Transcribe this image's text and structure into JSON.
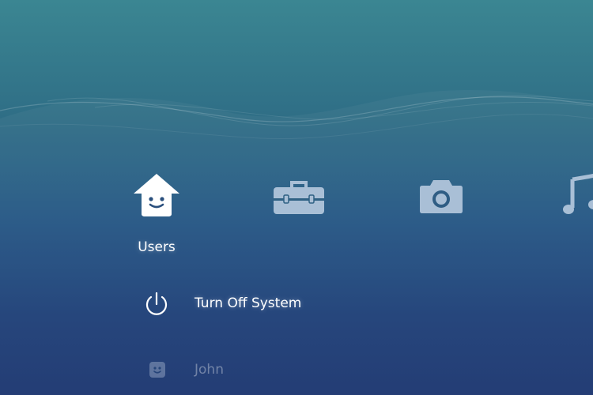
{
  "categories": [
    {
      "id": "users",
      "label": "Users",
      "icon": "user-home-icon",
      "selected": true
    },
    {
      "id": "tools",
      "label": "",
      "icon": "toolbox-icon",
      "selected": false
    },
    {
      "id": "photo",
      "label": "",
      "icon": "camera-icon",
      "selected": false
    },
    {
      "id": "music",
      "label": "",
      "icon": "music-note-icon",
      "selected": false
    }
  ],
  "selected_category_label": "Users",
  "menu": [
    {
      "id": "power",
      "label": "Turn Off System",
      "icon": "power-icon"
    },
    {
      "id": "user-john",
      "label": "John",
      "icon": "user-face-icon"
    }
  ],
  "colors": {
    "bg_top": "#3b8692",
    "bg_bottom": "#1c3670",
    "text": "#ffffff",
    "inactive_icon": "#a9bfd6"
  }
}
